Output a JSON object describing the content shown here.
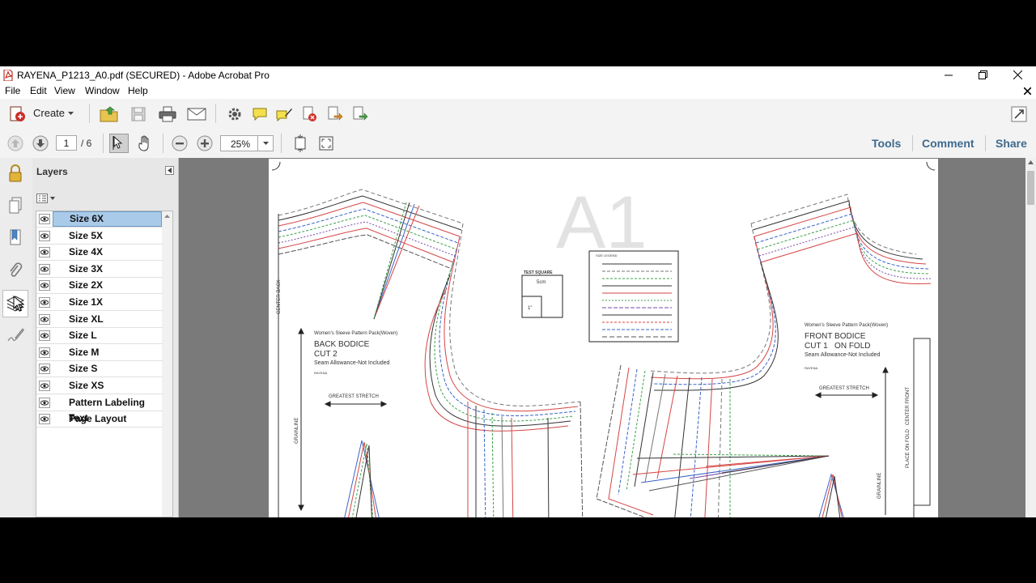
{
  "window": {
    "title": "RAYENA_P1213_A0.pdf (SECURED) - Adobe Acrobat Pro"
  },
  "menu": [
    "File",
    "Edit",
    "View",
    "Window",
    "Help"
  ],
  "toolbar": {
    "create_label": "Create",
    "page_current": "1",
    "page_total": "/ 6",
    "zoom": "25%",
    "tools_label": "Tools",
    "comment_label": "Comment",
    "share_label": "Share"
  },
  "layers_panel": {
    "title": "Layers",
    "items": [
      {
        "label": "Size 6X",
        "selected": true
      },
      {
        "label": "Size 5X",
        "selected": false
      },
      {
        "label": "Size 4X",
        "selected": false
      },
      {
        "label": "Size 3X",
        "selected": false
      },
      {
        "label": "Size 2X",
        "selected": false
      },
      {
        "label": "Size 1X",
        "selected": false
      },
      {
        "label": "Size XL",
        "selected": false
      },
      {
        "label": "Size L",
        "selected": false
      },
      {
        "label": "Size M",
        "selected": false
      },
      {
        "label": "Size S",
        "selected": false
      },
      {
        "label": "Size XS",
        "selected": false
      },
      {
        "label": "Pattern Labeling Text",
        "selected": false
      },
      {
        "label": "Page Layout",
        "selected": false
      }
    ]
  },
  "document": {
    "page_label": "A1",
    "test_square": {
      "title": "TEST SQUARE",
      "metric": "5cm",
      "imperial": "1\""
    },
    "size_legend_title": "SIZE LEGEND",
    "back_piece": {
      "pack": "Women's Sleeve Pattern Pack(Woven)",
      "name": "BACK BODICE",
      "cut": "CUT 2",
      "seam": "Seam Allowance-Not Included",
      "code": "RAYENA",
      "stretch": "GREATEST STRETCH",
      "grain": "GRAINLINE",
      "center": "CENTER BACK"
    },
    "front_piece": {
      "pack": "Women's Sleeve Pattern Pack(Woven)",
      "name": "FRONT BODICE",
      "cut": "CUT 1   ON FOLD",
      "seam": "Seam Allowance-Not Included",
      "code": "RAYENA",
      "stretch": "GREATEST STRETCH",
      "grain": "GRAINLINE",
      "fold": "PLACE ON FOLD   CENTER FRONT"
    }
  },
  "colors": {
    "toolbar_bg": "#f3f3f3",
    "doc_bg": "#7a7a7a",
    "selection": "#a9cbe9",
    "link": "#3e6a8e"
  }
}
